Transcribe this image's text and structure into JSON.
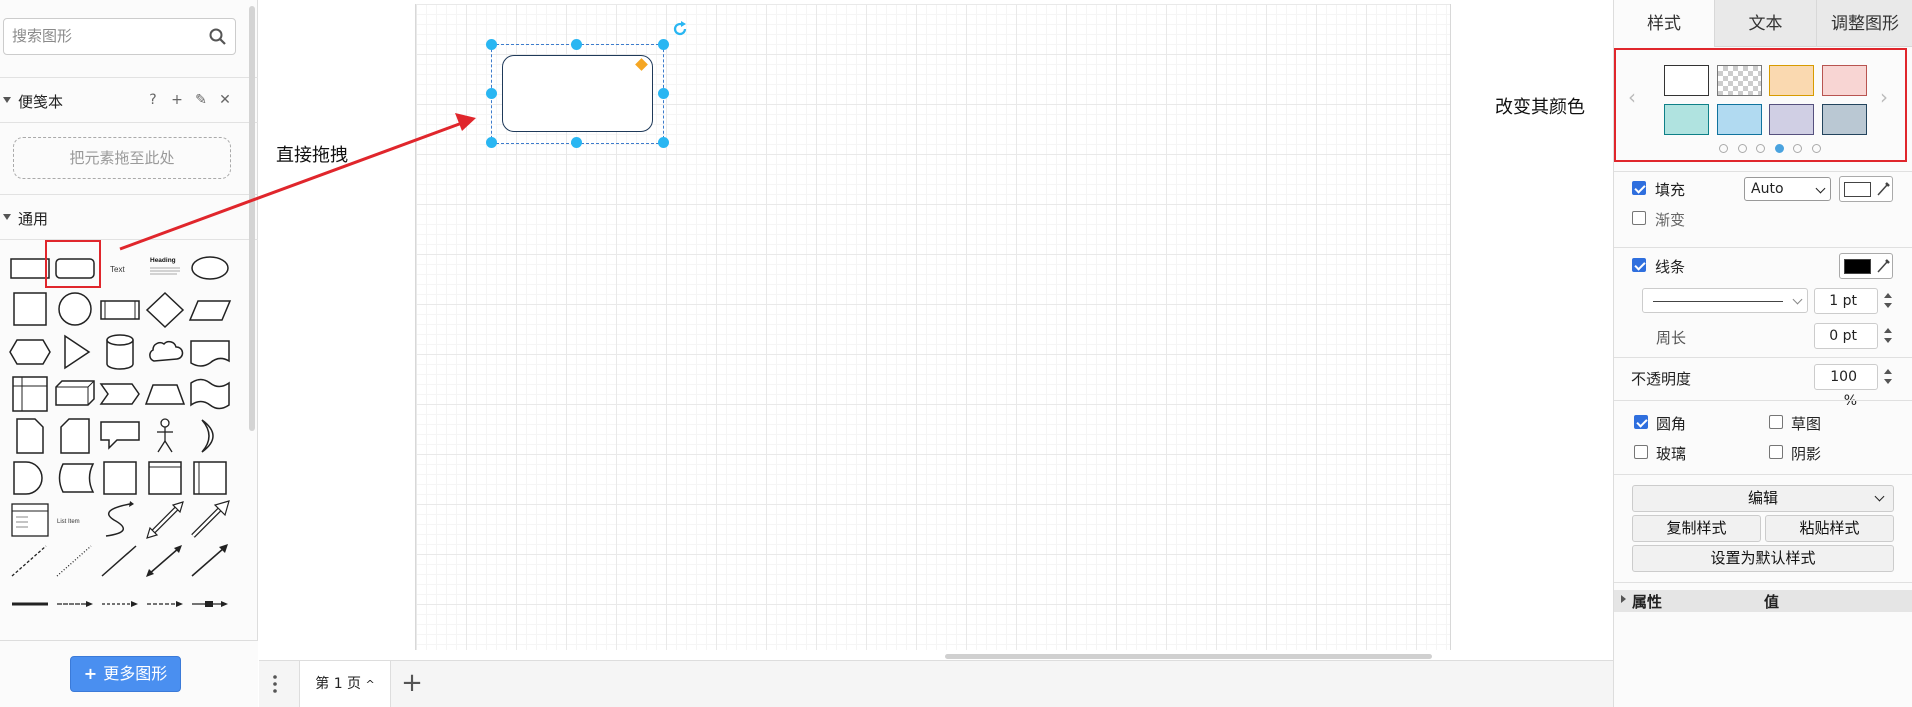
{
  "left_panel": {
    "search_placeholder": "搜索图形",
    "scratchpad": {
      "title": "便笺本",
      "tools": [
        "?",
        "+",
        "✎",
        "✕"
      ],
      "dropzone_text": "把元素拖至此处"
    },
    "general": {
      "title": "通用",
      "shape_labels": {
        "text": "Text",
        "heading": "Heading",
        "list_item": "List Item"
      }
    },
    "more_shapes_label": "更多图形"
  },
  "canvas": {
    "annotation_drag": "直接拖拽",
    "annotation_color": "改变其颜色"
  },
  "bottom_bar": {
    "page_tab": "第 1 页",
    "add_page": "+"
  },
  "right_panel": {
    "tabs": [
      "样式",
      "文本",
      "调整图形"
    ],
    "swatches": [
      "#ffffff",
      "checker",
      "#fad9b0",
      "#f8d5d3",
      "#b0e3e0",
      "#b1daf1",
      "#d0cfe4",
      "#bac8d3"
    ],
    "fill": {
      "label": "填充",
      "checked": true,
      "select": "Auto",
      "color": "#ffffff"
    },
    "gradient": {
      "label": "渐变",
      "checked": false
    },
    "line": {
      "label": "线条",
      "checked": true,
      "color": "#000000",
      "width": "1 pt"
    },
    "perimeter": {
      "label": "周长",
      "value": "0 pt"
    },
    "opacity": {
      "label": "不透明度",
      "value": "100 %"
    },
    "options": [
      {
        "label": "圆角",
        "checked": true
      },
      {
        "label": "草图",
        "checked": false
      },
      {
        "label": "玻璃",
        "checked": false
      },
      {
        "label": "阴影",
        "checked": false
      }
    ],
    "edit_select": "编辑",
    "copy_style": "复制样式",
    "paste_style": "粘贴样式",
    "set_default": "设置为默认样式",
    "prop_table": {
      "col1": "属性",
      "col2": "值"
    }
  }
}
